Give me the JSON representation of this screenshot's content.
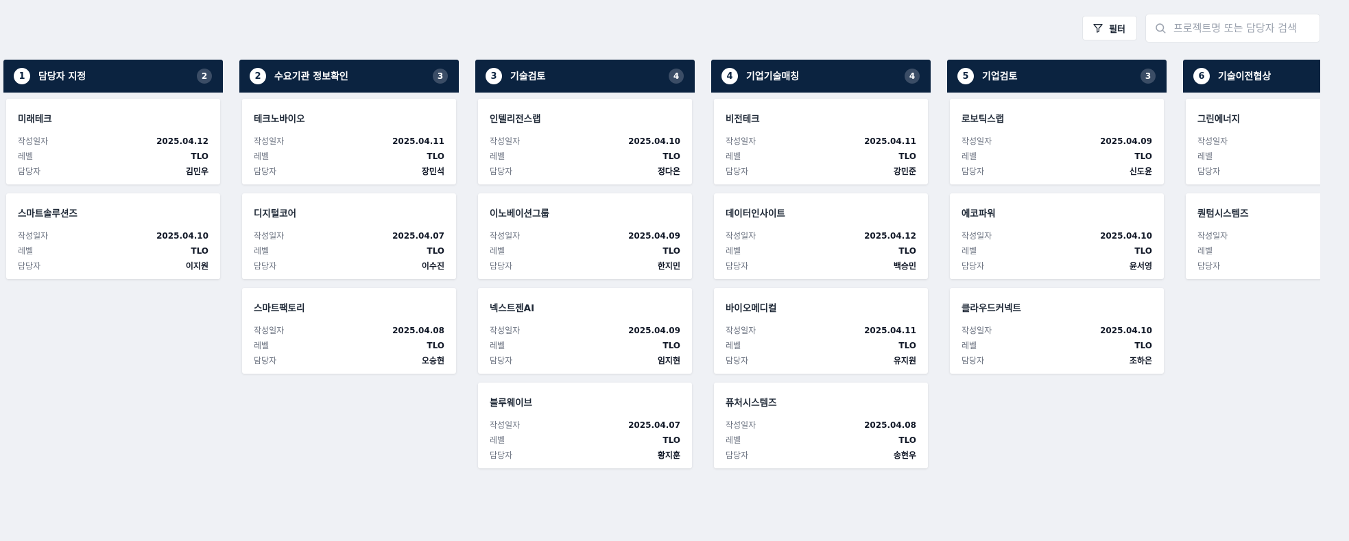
{
  "toolbar": {
    "filter_label": "필터",
    "search_placeholder": "프로젝트명 또는 담당자 검색"
  },
  "labels": {
    "date": "작성일자",
    "level": "레벨",
    "manager": "담당자"
  },
  "columns": [
    {
      "num": "1",
      "title": "담당자 지정",
      "count": "2",
      "cards": [
        {
          "name": "미래테크",
          "date": "2025.04.12",
          "level": "TLO",
          "manager": "김민우"
        },
        {
          "name": "스마트솔루션즈",
          "date": "2025.04.10",
          "level": "TLO",
          "manager": "이지원"
        }
      ]
    },
    {
      "num": "2",
      "title": "수요기관 정보확인",
      "count": "3",
      "cards": [
        {
          "name": "테크노바이오",
          "date": "2025.04.11",
          "level": "TLO",
          "manager": "장민석"
        },
        {
          "name": "디지털코어",
          "date": "2025.04.07",
          "level": "TLO",
          "manager": "이수진"
        },
        {
          "name": "스마트팩토리",
          "date": "2025.04.08",
          "level": "TLO",
          "manager": "오승현"
        }
      ]
    },
    {
      "num": "3",
      "title": "기술검토",
      "count": "4",
      "cards": [
        {
          "name": "인텔리전스랩",
          "date": "2025.04.10",
          "level": "TLO",
          "manager": "정다은"
        },
        {
          "name": "이노베이션그룹",
          "date": "2025.04.09",
          "level": "TLO",
          "manager": "한지민"
        },
        {
          "name": "넥스트젠AI",
          "date": "2025.04.09",
          "level": "TLO",
          "manager": "임지현"
        },
        {
          "name": "블루웨이브",
          "date": "2025.04.07",
          "level": "TLO",
          "manager": "황지훈"
        }
      ]
    },
    {
      "num": "4",
      "title": "기업기술매칭",
      "count": "4",
      "cards": [
        {
          "name": "비전테크",
          "date": "2025.04.11",
          "level": "TLO",
          "manager": "강민준"
        },
        {
          "name": "데이터인사이트",
          "date": "2025.04.12",
          "level": "TLO",
          "manager": "백승민"
        },
        {
          "name": "바이오메디컬",
          "date": "2025.04.11",
          "level": "TLO",
          "manager": "유지원"
        },
        {
          "name": "퓨처시스템즈",
          "date": "2025.04.08",
          "level": "TLO",
          "manager": "송현우"
        }
      ]
    },
    {
      "num": "5",
      "title": "기업검토",
      "count": "3",
      "cards": [
        {
          "name": "로보틱스랩",
          "date": "2025.04.09",
          "level": "TLO",
          "manager": "신도윤"
        },
        {
          "name": "에코파워",
          "date": "2025.04.10",
          "level": "TLO",
          "manager": "윤서영"
        },
        {
          "name": "클라우드커넥트",
          "date": "2025.04.10",
          "level": "TLO",
          "manager": "조하은"
        }
      ]
    },
    {
      "num": "6",
      "title": "기술이전협상",
      "count": "",
      "cards": [
        {
          "name": "그린에너지",
          "date": "",
          "level": "",
          "manager": ""
        },
        {
          "name": "퀀텀시스템즈",
          "date": "",
          "level": "",
          "manager": ""
        }
      ]
    }
  ]
}
